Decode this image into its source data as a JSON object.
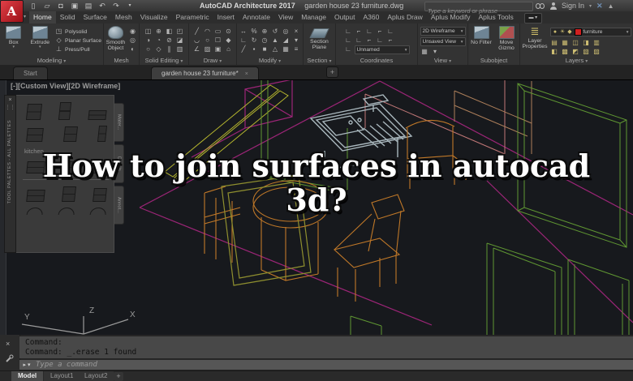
{
  "title_bar": {
    "app_title": "AutoCAD Architecture 2017",
    "document_name": "garden house 23 furniture.dwg",
    "search_placeholder": "Type a keyword or phrase",
    "sign_in_label": "Sign In"
  },
  "icons": {
    "new": "▯",
    "open": "▱",
    "save": "◘",
    "save_all": "▣",
    "plot": "▤",
    "undo": "↶",
    "redo": "↷",
    "caret": "▾",
    "close": "×",
    "triangle": "▲",
    "exchange_x": "✕",
    "plus": "+",
    "grip": "⋮⋮"
  },
  "ribbon": {
    "active_tab": "Home",
    "tabs": [
      "Home",
      "Solid",
      "Surface",
      "Mesh",
      "Visualize",
      "Parametric",
      "Insert",
      "Annotate",
      "View",
      "Manage",
      "Output",
      "A360",
      "Aplus Draw",
      "Aplus Modify",
      "Aplus Tools"
    ],
    "modeling": {
      "label": "Modeling",
      "box": "Box",
      "extrude": "Extrude",
      "polysolid": "Polysolid",
      "planar_surface": "Planar Surface",
      "press_pull": "Press/Pull"
    },
    "mesh": {
      "label": "Mesh",
      "smooth_object": "Smooth Object"
    },
    "solid_editing": {
      "label": "Solid Editing"
    },
    "draw": {
      "label": "Draw"
    },
    "modify": {
      "label": "Modify"
    },
    "section": {
      "label": "Section",
      "section_plane": "Section Plane"
    },
    "coordinates": {
      "label": "Coordinates",
      "named_ucs": "Unnamed"
    },
    "view": {
      "label": "View",
      "visual_style": "2D Wireframe",
      "saved_view": "Unsaved View"
    },
    "subobject": {
      "label": "Subobject",
      "no_filter": "No Filter",
      "move_gizmo": "Move Gizmo"
    },
    "layers": {
      "label": "Layers",
      "layer_properties": "Layer Properties",
      "current_layer": "furniture"
    }
  },
  "file_tabs": {
    "start": "Start",
    "document": "garden house 23 furniture*"
  },
  "viewport": {
    "controls": {
      "minimize": "[-]",
      "view_name": "[Custom View]",
      "visual_style": "[2D Wireframe]"
    },
    "overlay": {
      "line1": "How to join surfaces in autocad",
      "line2": "3d?"
    },
    "ucs": {
      "x": "X",
      "y": "Y",
      "z": "Z"
    }
  },
  "tool_palettes": {
    "titlebar": "TOOL PALETTES - ALL PALETTES",
    "group_label": "kitchen",
    "side_tabs": [
      "Mater...",
      "Details",
      "Annot..."
    ]
  },
  "command": {
    "history_line1": "Command:",
    "history_line2": "Command: _.erase 1 found",
    "input_placeholder": "Type a command"
  },
  "layout_tabs": {
    "model": "Model",
    "layout1": "Layout1",
    "layout2": "Layout2",
    "add_label": "+"
  },
  "colors": {
    "brand_red": "#c21d26",
    "layer_chip_red": "#d02020",
    "wire_green": "#5f9632",
    "wire_magenta": "#9c2577",
    "wire_orange": "#c07828",
    "wire_yellow": "#b5b52e",
    "wire_olive": "#8f8f2f",
    "wire_gray": "#a9b7bd",
    "overlay_text": "#ffffff"
  }
}
